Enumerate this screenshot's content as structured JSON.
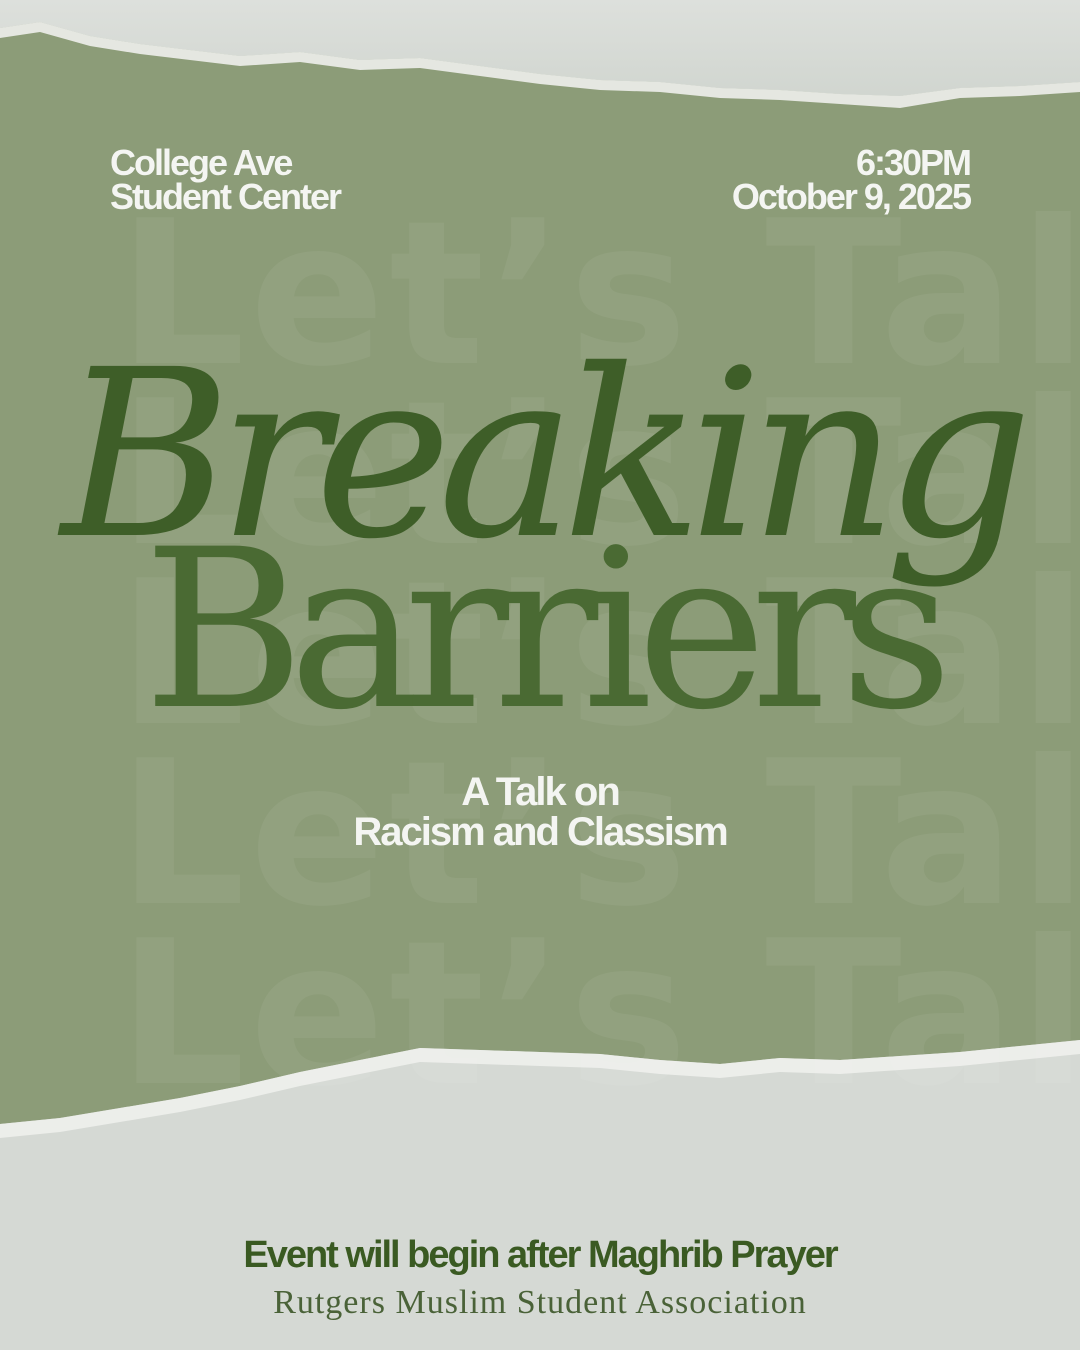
{
  "location": {
    "line1": "College Ave",
    "line2": "Student Center"
  },
  "datetime": {
    "time": "6:30PM",
    "date": "October 9, 2025"
  },
  "watermark": {
    "lines": [
      "Let’s Talk",
      "Let’s Talk",
      "Let’s Talk",
      "Let’s Talk",
      "Let’s Talk"
    ]
  },
  "title": {
    "line1": "Breaking",
    "line2": "Barriers"
  },
  "subtitle": {
    "line1": "A Talk on",
    "line2": "Racism and Classism"
  },
  "footer": {
    "note": "Event will begin after Maghrib Prayer",
    "organization": "Rutgers Muslim Student Association"
  },
  "colors": {
    "panel": "#8c9c78",
    "paper": "#d5d9d4",
    "title_dark_green": "#3e5e28",
    "title_green": "#4a6a33",
    "light_text": "#f4f5f2"
  }
}
